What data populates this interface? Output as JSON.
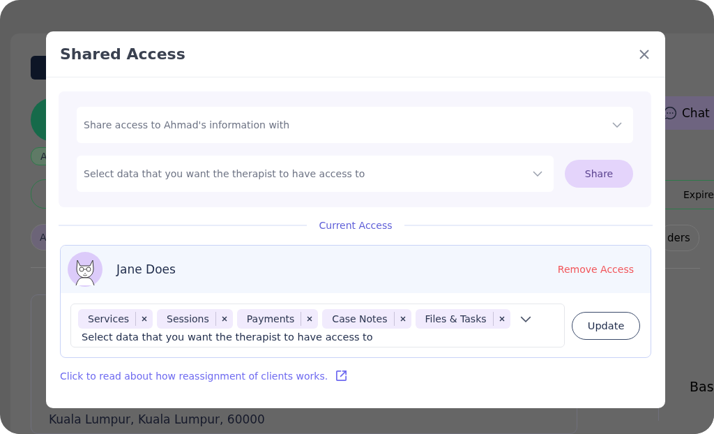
{
  "background": {
    "chips": [
      "A",
      "A"
    ],
    "chat_button": "Chat",
    "tab_fragment": "Expire",
    "pill_fragment": "ders",
    "heading_fragment": "Bas",
    "address": "Kuala Lumpur, Kuala Lumpur, 60000"
  },
  "dialog": {
    "title": "Shared Access",
    "share_with": {
      "placeholder": "Share access to Ahmad's information with"
    },
    "data_select": {
      "placeholder": "Select data that you want the therapist to have access to"
    },
    "share_button": "Share",
    "section_label": "Current Access",
    "access": [
      {
        "name": "Jane Does",
        "remove_label": "Remove Access",
        "tags": [
          "Services",
          "Sessions",
          "Payments",
          "Case Notes",
          "Files & Tasks"
        ],
        "placeholder": "Select data that you want the therapist to have access to",
        "update_button": "Update"
      }
    ],
    "help_link": "Click to read about how reassignment of clients works."
  }
}
